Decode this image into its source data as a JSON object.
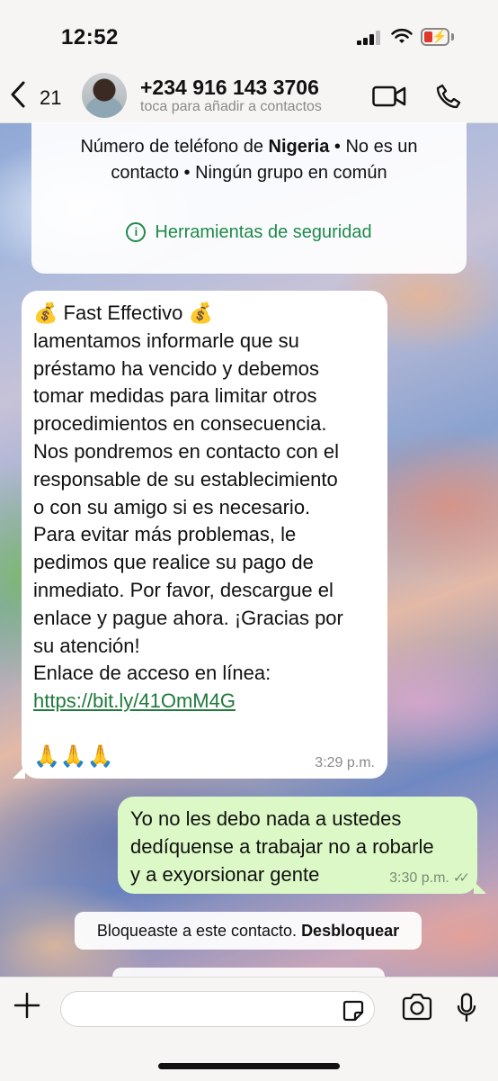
{
  "status_bar": {
    "time": "12:52"
  },
  "header": {
    "back_count": "21",
    "contact_name": "+234 916 143 3706",
    "contact_subtitle": "toca para añadir a contactos"
  },
  "info_card": {
    "line1_prefix": "Número de teléfono de ",
    "line1_country": "Nigeria",
    "line1_suffix": " • No es un",
    "line2": "contacto • Ningún grupo en común",
    "security_link": "Herramientas de seguridad"
  },
  "messages": {
    "incoming": {
      "lines": [
        "💰 Fast Effectivo 💰",
        " lamentamos informarle que su",
        "préstamo ha vencido y debemos",
        "tomar medidas para limitar otros",
        "procedimientos en consecuencia.",
        "Nos pondremos en contacto con el",
        "responsable de su establecimiento",
        "o con su amigo si es necesario.",
        "Para evitar más problemas, le",
        "pedimos que realice su pago de",
        "inmediato. Por favor, descargue el",
        "enlace y pague ahora. ¡Gracias por",
        "su atención!",
        "Enlace de acceso en línea:"
      ],
      "link": "https://bit.ly/41OmM4G",
      "emoji": "🙏🙏🙏",
      "time": "3:29 p.m."
    },
    "outgoing": {
      "lines": [
        "Yo no les debo nada a ustedes",
        "dedíquense a trabajar no a robarle",
        "y a exyorsionar gente"
      ],
      "time": "3:30 p.m.",
      "ticks": "✓✓"
    }
  },
  "system_notice": {
    "text": "Bloqueaste a este contacto. ",
    "action": "Desbloquear"
  },
  "input_bar": {
    "placeholder": ""
  },
  "colors": {
    "accent_green": "#1e8a4a",
    "outgoing_bubble": "#dcf8c6",
    "battery_low": "#e0362c"
  }
}
